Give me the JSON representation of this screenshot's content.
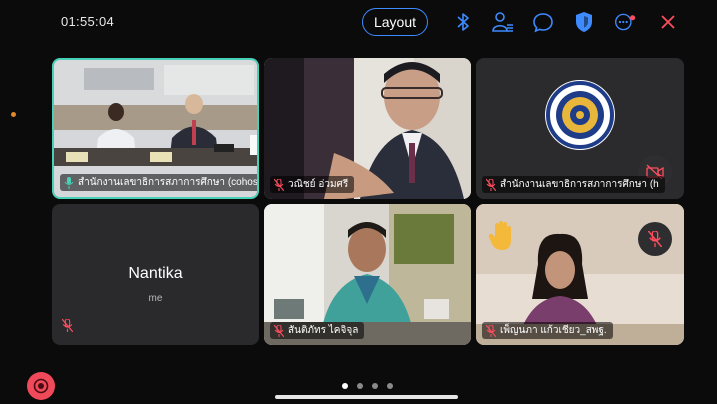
{
  "meeting": {
    "elapsed_time": "01:55:04"
  },
  "toolbar": {
    "layout_label": "Layout"
  },
  "tiles": [
    {
      "name": "สำนักงานเลขาธิการสภาการศึกษา (cohost)"
    },
    {
      "name": "วณิชย์ อ่วมศรี"
    },
    {
      "name": "สำนักงานเลขาธิการสภาการศึกษา (h"
    },
    {
      "name": "Nantika",
      "sub": "me"
    },
    {
      "name": "สันติภัทร ไคจิจุล"
    },
    {
      "name": "เพ็ญนภา แก้วเชียว_สพฐ."
    }
  ],
  "pager": {
    "total": 4,
    "current": 1
  },
  "colors": {
    "accent": "#3d8bff",
    "active_border": "#46d1b8",
    "leave": "#f04a5a",
    "mute": "#ff4d5e"
  }
}
